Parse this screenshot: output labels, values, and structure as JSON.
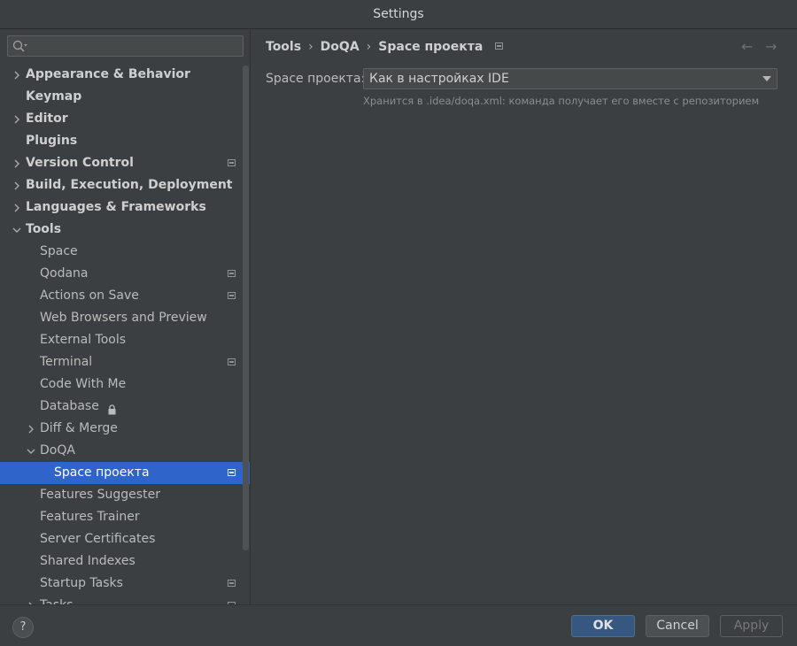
{
  "window": {
    "title": "Settings"
  },
  "sidebar": {
    "search": {
      "placeholder": "",
      "value": ""
    },
    "items": [
      {
        "label": "Appearance & Behavior",
        "level": 0,
        "bold": true,
        "arrow": "right"
      },
      {
        "label": "Keymap",
        "level": 0,
        "bold": true,
        "arrow": "none"
      },
      {
        "label": "Editor",
        "level": 0,
        "bold": true,
        "arrow": "right"
      },
      {
        "label": "Plugins",
        "level": 0,
        "bold": true,
        "arrow": "none"
      },
      {
        "label": "Version Control",
        "level": 0,
        "bold": true,
        "arrow": "right",
        "project": true
      },
      {
        "label": "Build, Execution, Deployment",
        "level": 0,
        "bold": true,
        "arrow": "right"
      },
      {
        "label": "Languages & Frameworks",
        "level": 0,
        "bold": true,
        "arrow": "right"
      },
      {
        "label": "Tools",
        "level": 0,
        "bold": true,
        "arrow": "down"
      },
      {
        "label": "Space",
        "level": 1,
        "arrow": "none"
      },
      {
        "label": "Qodana",
        "level": 1,
        "arrow": "none",
        "project": true
      },
      {
        "label": "Actions on Save",
        "level": 1,
        "arrow": "none",
        "project": true
      },
      {
        "label": "Web Browsers and Preview",
        "level": 1,
        "arrow": "none"
      },
      {
        "label": "External Tools",
        "level": 1,
        "arrow": "none"
      },
      {
        "label": "Terminal",
        "level": 1,
        "arrow": "none",
        "project": true
      },
      {
        "label": "Code With Me",
        "level": 1,
        "arrow": "none"
      },
      {
        "label": "Database",
        "level": 1,
        "arrow": "none",
        "lock": true
      },
      {
        "label": "Diff & Merge",
        "level": 1,
        "arrow": "right"
      },
      {
        "label": "DoQA",
        "level": 1,
        "arrow": "down"
      },
      {
        "label": "Space проекта",
        "level": 2,
        "arrow": "none",
        "project": true,
        "selected": true
      },
      {
        "label": "Features Suggester",
        "level": 1,
        "arrow": "none"
      },
      {
        "label": "Features Trainer",
        "level": 1,
        "arrow": "none"
      },
      {
        "label": "Server Certificates",
        "level": 1,
        "arrow": "none"
      },
      {
        "label": "Shared Indexes",
        "level": 1,
        "arrow": "none"
      },
      {
        "label": "Startup Tasks",
        "level": 1,
        "arrow": "none",
        "project": true
      },
      {
        "label": "Tasks",
        "level": 1,
        "arrow": "right",
        "project": true
      }
    ]
  },
  "breadcrumb": {
    "items": [
      "Tools",
      "DoQA",
      "Space проекта"
    ],
    "separator": "›"
  },
  "nav": {
    "back": "←",
    "forward": "→"
  },
  "form": {
    "label": "Space проекта:",
    "selected": "Как в настройках IDE",
    "hint": "Хранится в .idea/doqa.xml: команда получает его вместе с репозиторием"
  },
  "footer": {
    "help": "?",
    "ok": "OK",
    "cancel": "Cancel",
    "apply": "Apply"
  },
  "colors": {
    "selection": "#2f65ca",
    "background": "#3c3f41",
    "ok_button": "#365880"
  }
}
